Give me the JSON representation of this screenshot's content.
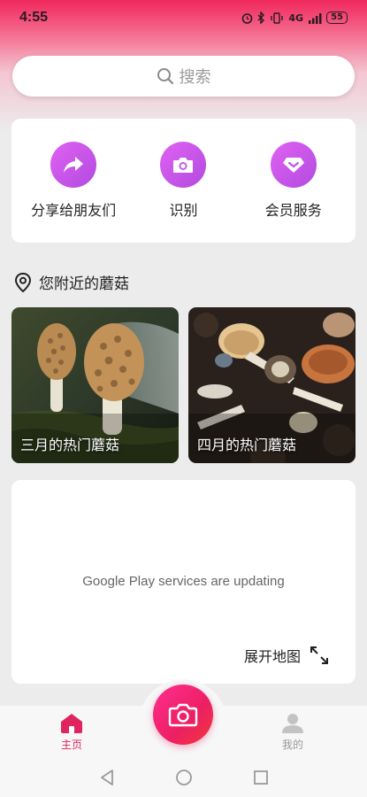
{
  "status_bar": {
    "time": "4:55",
    "network": "4G",
    "battery": "55"
  },
  "search": {
    "label": "搜索"
  },
  "quick_actions": [
    {
      "label": "分享给朋友们",
      "icon": "share-arrow-icon"
    },
    {
      "label": "识别",
      "icon": "camera-icon"
    },
    {
      "label": "会员服务",
      "icon": "diamond-icon"
    }
  ],
  "nearby": {
    "title": "您附近的蘑菇"
  },
  "mushroom_cards": [
    {
      "caption": "三月的热门蘑菇"
    },
    {
      "caption": "四月的热门蘑菇"
    }
  ],
  "map": {
    "message": "Google Play services are updating",
    "expand_label": "展开地图"
  },
  "bottom_nav": {
    "home_label": "主页",
    "profile_label": "我的"
  },
  "colors": {
    "accent": "#ec1f63",
    "purple": "#c056ea",
    "home_active": "#e0245e"
  }
}
